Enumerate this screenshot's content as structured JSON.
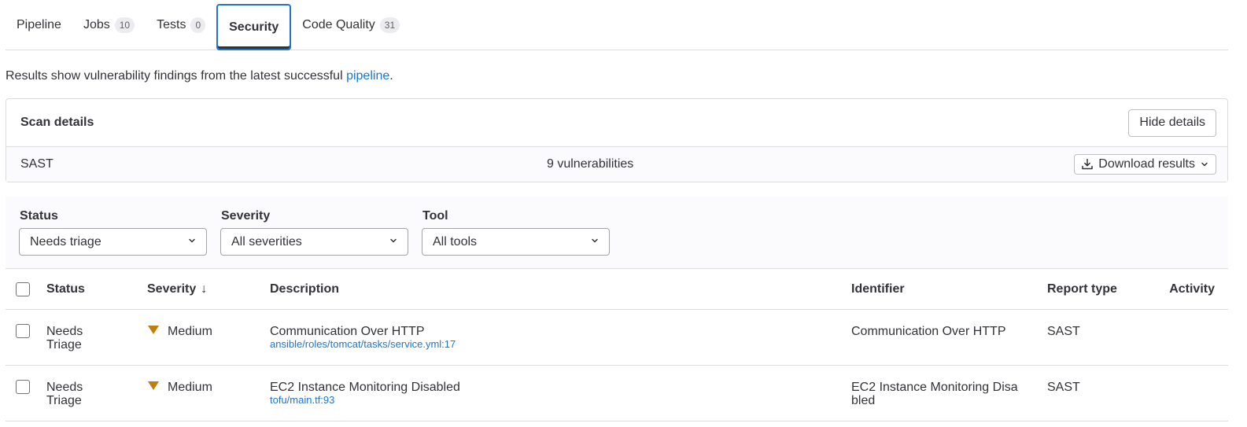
{
  "tabs": [
    {
      "label": "Pipeline",
      "count": null
    },
    {
      "label": "Jobs",
      "count": "10"
    },
    {
      "label": "Tests",
      "count": "0"
    },
    {
      "label": "Security",
      "count": null,
      "active": true
    },
    {
      "label": "Code Quality",
      "count": "31"
    }
  ],
  "intro": {
    "text": "Results show vulnerability findings from the latest successful ",
    "link": "pipeline",
    "suffix": "."
  },
  "scan": {
    "title": "Scan details",
    "hide_label": "Hide details",
    "scanner": "SAST",
    "vulnerabilities": "9 vulnerabilities",
    "download_label": "Download results"
  },
  "filters": {
    "status": {
      "label": "Status",
      "value": "Needs triage"
    },
    "severity": {
      "label": "Severity",
      "value": "All severities"
    },
    "tool": {
      "label": "Tool",
      "value": "All tools"
    }
  },
  "table": {
    "headers": {
      "status": "Status",
      "severity": "Severity",
      "description": "Description",
      "identifier": "Identifier",
      "report_type": "Report type",
      "activity": "Activity"
    },
    "rows": [
      {
        "status_line1": "Needs",
        "status_line2": "Triage",
        "severity": "Medium",
        "description": "Communication Over HTTP",
        "location": "ansible/roles/tomcat/tasks/service.yml:17",
        "identifier": "Communication Over HTTP",
        "report_type": "SAST"
      },
      {
        "status_line1": "Needs",
        "status_line2": "Triage",
        "severity": "Medium",
        "description": "EC2 Instance Monitoring Disabled",
        "location": "tofu/main.tf:93",
        "identifier_line1": "EC2 Instance Monitoring Disa",
        "identifier_line2": "bled",
        "report_type": "SAST"
      }
    ]
  },
  "colors": {
    "link": "#1f75cb",
    "medium_severity": "#c17d10",
    "active_tab_border": "#1f75cb"
  }
}
